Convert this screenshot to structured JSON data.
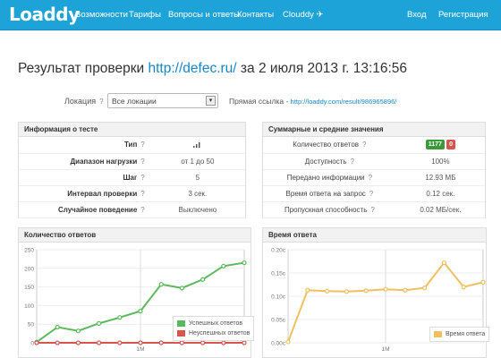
{
  "navbar": {
    "logo": "Loaddy",
    "items": [
      "Возможности",
      "Тарифы",
      "Вопросы и ответы",
      "Контакты",
      "Clouddy ✈"
    ],
    "login": "Вход",
    "register": "Регистрация",
    "bg_color": "#1ea3d8"
  },
  "title": {
    "prefix": "Результат проверки",
    "url": "http://defec.ru/",
    "suffix": "за 2 июля 2013 г. 13:16:56"
  },
  "location": {
    "label": "Локация",
    "help": "?",
    "selected": "Все локации"
  },
  "permalink": {
    "label": "Прямая ссылка -",
    "url": "http://loaddy.com/result/986965896/"
  },
  "test_info": {
    "header": "Информация о тесте",
    "rows": [
      {
        "key": "Тип",
        "value": "signal-icon"
      },
      {
        "key": "Диапазон нагрузки",
        "value": "от 1 до 50"
      },
      {
        "key": "Шаг",
        "value": "5"
      },
      {
        "key": "Интервал проверки",
        "value": "3 сек."
      },
      {
        "key": "Случайное поведение",
        "value": "Выключено"
      }
    ]
  },
  "summary": {
    "header": "Суммарные и средние значения",
    "responses_label": "Количество ответов",
    "responses_ok": "1177",
    "responses_fail": "0",
    "ok_color": "#3a9a3a",
    "fail_color": "#d9534f",
    "rows": [
      {
        "key": "Доступность",
        "value": "100%"
      },
      {
        "key": "Передано информации",
        "value": "12.93 МБ"
      },
      {
        "key": "Время ответа на запрос",
        "value": "0.12 сек."
      },
      {
        "key": "Пропускная способность",
        "value": "0.02 МБ/сек."
      }
    ]
  },
  "chart_data": [
    {
      "type": "line",
      "title": "Количество ответов",
      "x_tick": "1M",
      "ylim": [
        0,
        250
      ],
      "yticks": [
        "0",
        "50",
        "100",
        "150",
        "200",
        "250"
      ],
      "series": [
        {
          "name": "Успешных ответов",
          "color": "#5cb85c",
          "values": [
            2,
            42,
            32,
            52,
            68,
            85,
            157,
            147,
            170,
            206,
            215
          ]
        },
        {
          "name": "Неуспешных ответов",
          "color": "#d9534f",
          "values": [
            0,
            0,
            0,
            0,
            0,
            0,
            0,
            0,
            0,
            0,
            0
          ]
        }
      ],
      "legend_position": "bottom-right"
    },
    {
      "type": "line",
      "title": "Время ответа",
      "x_tick": "1M",
      "ylim": [
        0,
        0.2
      ],
      "yticks": [
        "0.00c",
        "0.05c",
        "0.10c",
        "0.15c",
        "0.20c"
      ],
      "series": [
        {
          "name": "Время ответа",
          "color": "#f0c060",
          "values": [
            0.002,
            0.113,
            0.111,
            0.11,
            0.112,
            0.115,
            0.113,
            0.118,
            0.172,
            0.12,
            0.13
          ]
        }
      ],
      "legend_position": "bottom-right"
    }
  ]
}
